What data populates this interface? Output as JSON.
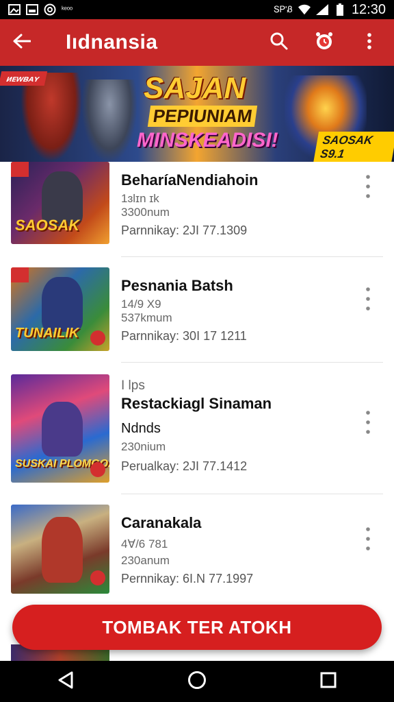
{
  "status_bar": {
    "left_icons": [
      "image-icon",
      "photo-icon",
      "at-sign-icon"
    ],
    "tiny_text": "ᵏᵉᵒᵒ",
    "signal_text": "ՏᏢ'Ᏸ",
    "clock": "12:30"
  },
  "app_bar": {
    "title": "Iıdnansia",
    "icons": [
      "back-arrow-icon",
      "search-icon",
      "alarm-icon",
      "more-vert-icon"
    ]
  },
  "banner": {
    "tag": "ᴎᴇᴡʙᴀʏ",
    "line1": "SAJAN",
    "line2": "PEPIUNIAM",
    "line3": "MINSKEADISI!",
    "badge": "SAOSAK S9.1"
  },
  "items": [
    {
      "title": "BeharíaNendiahoin",
      "line_a": "1ɜlɪn ɪk",
      "line_b": "3300num",
      "meta": "Parnnikay: 2JI 77.1309",
      "thumb_text": "SAOSAK"
    },
    {
      "title": "Pesnania Batsh",
      "line_a": "14/9 Χ9",
      "line_b": "537kmum",
      "meta": "Parnnikay: 30I 17 1211",
      "thumb_text": "TUNAILIK"
    },
    {
      "title": "Restackiagl Sinaman",
      "kicker": "I lps",
      "line_a": "Ndnds",
      "line_b": "230nium",
      "meta": "Perualkay: 2JI 77.1412",
      "thumb_text": "SUSKAI PLOMGOA"
    },
    {
      "title": "Caranakala",
      "line_a": "4Ɐ/6 781",
      "line_b": "230anum",
      "meta": "Pernnikay: 6I.N 77.1997",
      "thumb_text": ""
    }
  ],
  "cta": {
    "label": "TOMBAK TER ATOKH"
  },
  "nav_bar": {
    "icons": [
      "back-triangle-icon",
      "home-circle-icon",
      "recents-square-icon"
    ]
  },
  "colors": {
    "primary": "#c62828",
    "cta": "#d61f1f",
    "text": "#111111",
    "muted": "#666666"
  }
}
